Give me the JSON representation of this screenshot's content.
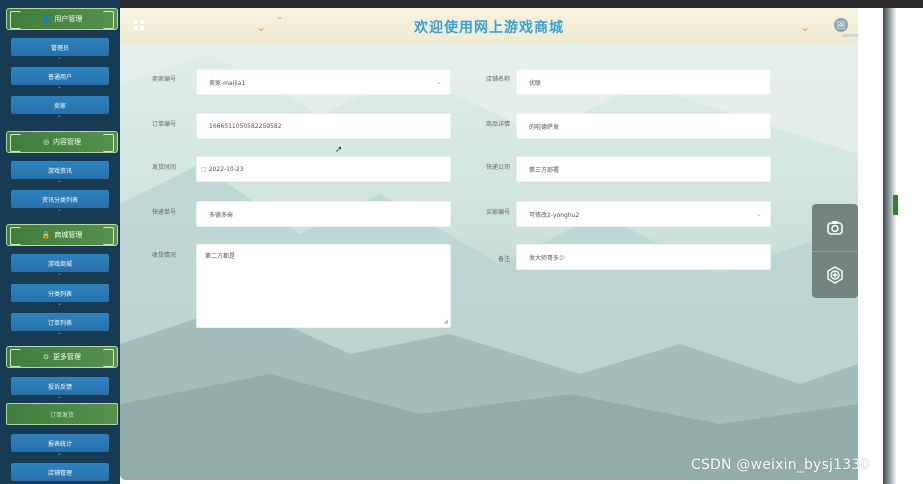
{
  "sidebar": {
    "groups": [
      {
        "label": "用户管理",
        "icon": "user-icon"
      },
      {
        "label": "内容管理",
        "icon": "chat-icon"
      },
      {
        "label": "商城管理",
        "icon": "lock-icon"
      },
      {
        "label": "更多管理",
        "icon": "more-icon"
      }
    ],
    "items": [
      {
        "label": "管理员"
      },
      {
        "label": "普通用户"
      },
      {
        "label": "卖家"
      },
      {
        "label": "游戏资讯"
      },
      {
        "label": "资讯分类列表"
      },
      {
        "label": "游戏商城"
      },
      {
        "label": "分类列表"
      },
      {
        "label": "订单列表"
      },
      {
        "label": "投诉反馈"
      },
      {
        "label": "订单发货"
      },
      {
        "label": "报表统计"
      },
      {
        "label": "店铺管理"
      }
    ]
  },
  "header": {
    "title": "欢迎使用网上游戏商城",
    "avatar_glyph": "🖼",
    "accent": "#3aa0d8"
  },
  "form": {
    "seller_id": {
      "label": "卖家编号",
      "value": "卖家-maijia1"
    },
    "shop_name": {
      "label": "店铺名称",
      "value": "优联"
    },
    "order_no": {
      "label": "订单编号",
      "value": "1666511050582259582"
    },
    "product_detail": {
      "label": "商品详情",
      "value": "的啦德萨发"
    },
    "ship_time": {
      "label": "发货时间",
      "value": "2022-10-23"
    },
    "courier": {
      "label": "快递公司",
      "value": "第三方部署"
    },
    "tracking_no": {
      "label": "快递单号",
      "value": "多德多肏"
    },
    "buyer_id": {
      "label": "买家编号",
      "value": "可修改2-yonghu2"
    },
    "receive_status": {
      "label": "收货情况",
      "value": "第二方都是"
    },
    "remark": {
      "label": "备注",
      "value": "发大师哥多少"
    }
  },
  "tools": {
    "camera": "camera-icon",
    "badge": "badge-plus-icon"
  },
  "watermark": "CSDN @weixin_bysj1330"
}
